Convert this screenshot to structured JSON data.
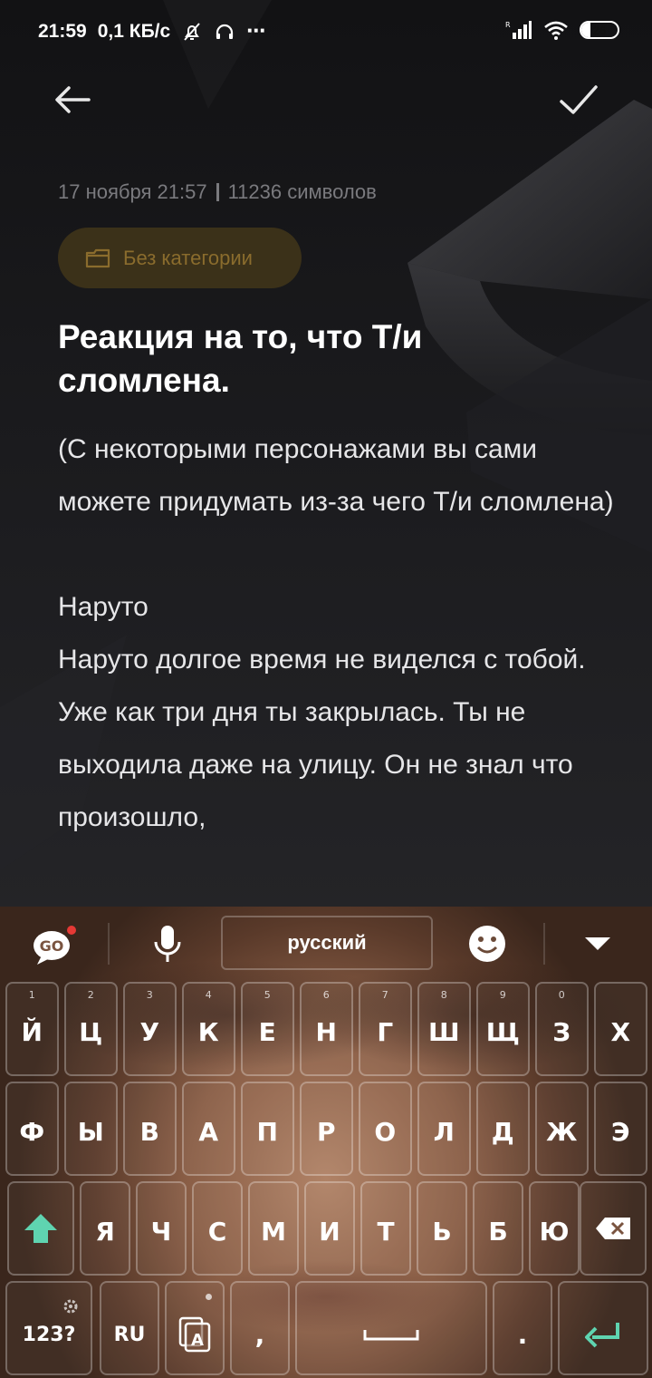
{
  "status_bar": {
    "time": "21:59",
    "speed": "0,1 КБ/с",
    "battery": "26",
    "battery_level": 0.26
  },
  "note": {
    "date": "17 ноября  21:57",
    "char_count": "11236 символов",
    "category": "Без категории",
    "title": "Реакция на то, что Т/и сломлена.",
    "paragraphs": [
      "(С некоторыми персонажами вы сами можете придумать из-за чего Т/и сломлена)",
      "",
      "Наруто",
      "Наруто долгое время не виделся с тобой. Уже как три дня ты закрылась. Ты не выходила даже на улицу. Он не знал что произошло,"
    ]
  },
  "keyboard": {
    "language": "русский",
    "accent_color": "#5fd4b0",
    "row1": [
      "й",
      "ц",
      "у",
      "к",
      "е",
      "н",
      "г",
      "ш",
      "щ",
      "з",
      "х"
    ],
    "row1_hints": [
      "1",
      "2",
      "3",
      "4",
      "5",
      "6",
      "7",
      "8",
      "9",
      "0",
      ""
    ],
    "row2": [
      "ф",
      "ы",
      "в",
      "а",
      "п",
      "р",
      "о",
      "л",
      "д",
      "ж",
      "э"
    ],
    "row3": [
      "я",
      "ч",
      "с",
      "м",
      "и",
      "т",
      "ь",
      "б",
      "ю"
    ],
    "bottom": {
      "numbers": "123?",
      "lang": "RU",
      "comma": ",",
      "period": "."
    }
  }
}
